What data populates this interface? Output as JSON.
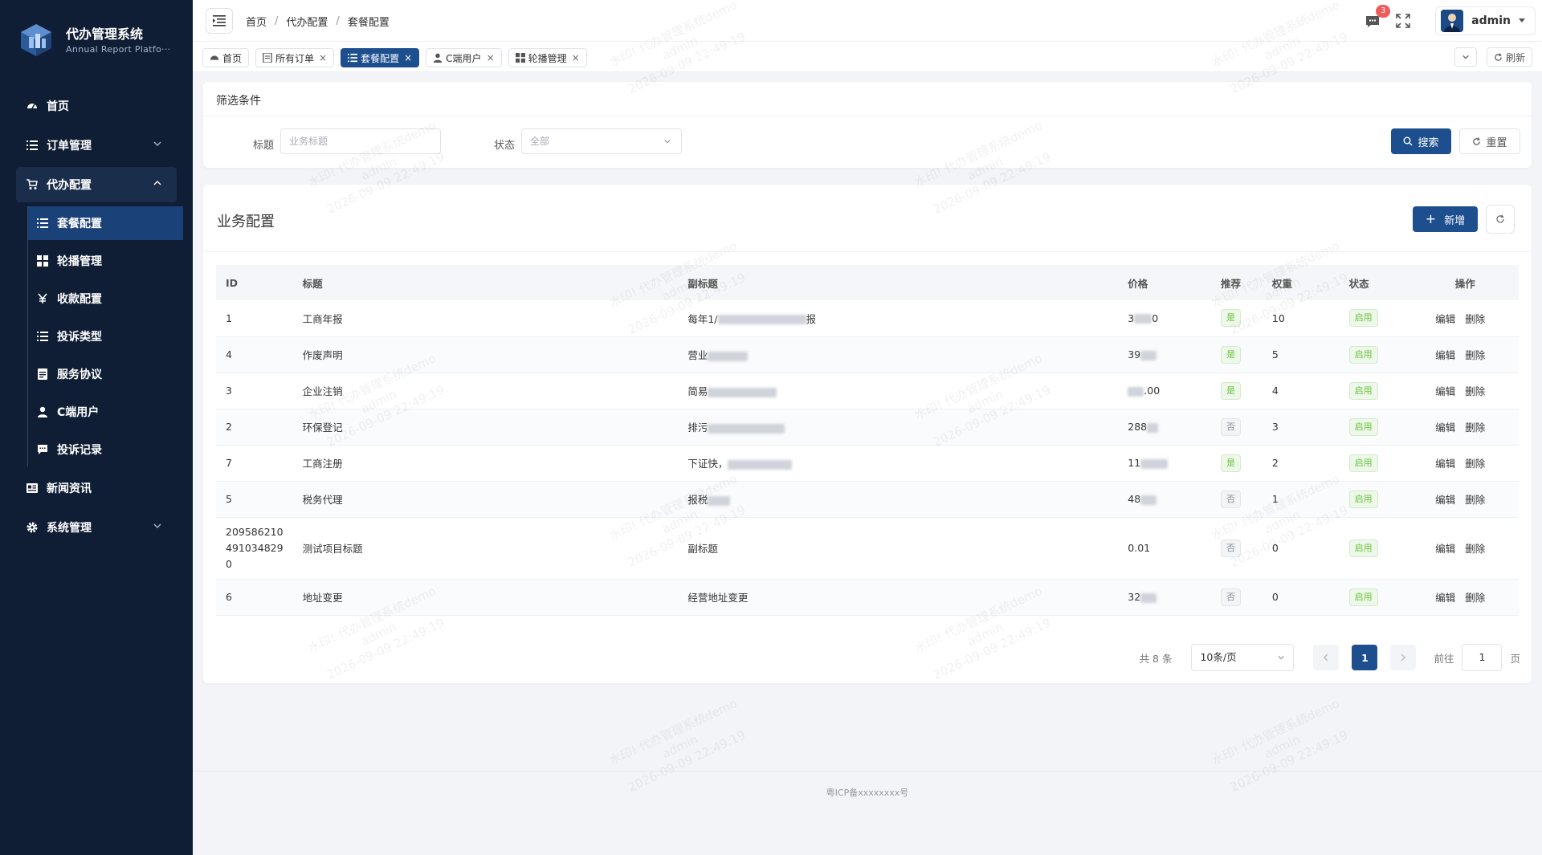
{
  "app": {
    "title": "代办管理系统",
    "subtitle": "Annual Report Platfo···"
  },
  "sidebar": {
    "items": [
      {
        "label": "首页",
        "icon": "dashboard-icon"
      },
      {
        "label": "订单管理",
        "icon": "list-icon"
      },
      {
        "label": "代办配置",
        "icon": "cart-icon"
      },
      {
        "label": "新闻资讯",
        "icon": "news-icon"
      },
      {
        "label": "系统管理",
        "icon": "gear-icon"
      }
    ],
    "submenu": [
      {
        "label": "套餐配置",
        "icon": "list-icon"
      },
      {
        "label": "轮播管理",
        "icon": "grid-icon"
      },
      {
        "label": "收款配置",
        "icon": "yen-icon"
      },
      {
        "label": "投诉类型",
        "icon": "list-icon"
      },
      {
        "label": "服务协议",
        "icon": "document-icon"
      },
      {
        "label": "C端用户",
        "icon": "user-icon"
      },
      {
        "label": "投诉记录",
        "icon": "chat-icon"
      }
    ]
  },
  "header": {
    "breadcrumb": [
      "首页",
      "代办配置",
      "套餐配置"
    ],
    "badge_count": "3",
    "user": "admin"
  },
  "tabs": [
    {
      "label": "首页",
      "icon": "dashboard-icon",
      "closable": false
    },
    {
      "label": "所有订单",
      "icon": "document-icon",
      "closable": true
    },
    {
      "label": "套餐配置",
      "icon": "list-icon",
      "closable": true
    },
    {
      "label": "C端用户",
      "icon": "user-icon",
      "closable": true
    },
    {
      "label": "轮播管理",
      "icon": "grid-icon",
      "closable": true
    }
  ],
  "tabs_refresh": "刷新",
  "filter": {
    "title": "筛选条件",
    "title_label": "标题",
    "title_placeholder": "业务标题",
    "status_label": "状态",
    "status_value": "全部",
    "search": "搜索",
    "reset": "重置"
  },
  "table_card": {
    "title": "业务配置",
    "add": "新增"
  },
  "table": {
    "headers": [
      "ID",
      "标题",
      "副标题",
      "价格",
      "推荐",
      "权重",
      "状态",
      "操作"
    ],
    "rows": [
      {
        "id": "1",
        "title": "工商年报",
        "subtitle": "每年1/",
        "subtitle_tail": "报",
        "price": "3",
        "price_tail": "0",
        "rec": "是",
        "weight": "10",
        "status": "启用"
      },
      {
        "id": "4",
        "title": "作废声明",
        "subtitle": "营业",
        "subtitle_tail": "",
        "price": "39",
        "price_tail": "",
        "rec": "是",
        "weight": "5",
        "status": "启用"
      },
      {
        "id": "3",
        "title": "企业注销",
        "subtitle": "简易",
        "subtitle_tail": "",
        "price": "",
        "price_tail": ".00",
        "rec": "是",
        "weight": "4",
        "status": "启用"
      },
      {
        "id": "2",
        "title": "环保登记",
        "subtitle": "排污",
        "subtitle_tail": "",
        "price": "288",
        "price_tail": "",
        "rec": "否",
        "weight": "3",
        "status": "启用"
      },
      {
        "id": "7",
        "title": "工商注册",
        "subtitle": "下证快，",
        "subtitle_tail": "",
        "price": "11",
        "price_tail": "",
        "rec": "是",
        "weight": "2",
        "status": "启用"
      },
      {
        "id": "5",
        "title": "税务代理",
        "subtitle": "报税",
        "subtitle_tail": "",
        "price": "48",
        "price_tail": "",
        "rec": "否",
        "weight": "1",
        "status": "启用"
      },
      {
        "id": "2095862104910348290",
        "id_lines": [
          "209586210",
          "491034829",
          "0"
        ],
        "title": "测试项目标题",
        "subtitle": "副标题",
        "subtitle_tail": "",
        "price": "0.01",
        "price_tail": "",
        "rec": "否",
        "weight": "0",
        "status": "启用"
      },
      {
        "id": "6",
        "title": "地址变更",
        "subtitle": "经营地址变更",
        "subtitle_tail": "",
        "price": "32",
        "price_tail": "",
        "rec": "否",
        "weight": "0",
        "status": "启用"
      }
    ],
    "actions": [
      "编辑",
      "删除"
    ]
  },
  "pager": {
    "total": "共 8 条",
    "page_size": "10条/页",
    "current": "1",
    "goto_label": "前往",
    "goto_value": "1",
    "page_suffix": "页"
  },
  "footer": {
    "icp": "粤ICP备xxxxxxxx号"
  },
  "watermark": [
    "水印! 代办管理系统demo",
    "admin",
    "2026-09-09 22:49:19"
  ],
  "colors": {
    "sidebar_bg": "#0f1e35",
    "primary": "#1d4f8f",
    "success": "#67c23a",
    "badge": "#f15a5a"
  }
}
